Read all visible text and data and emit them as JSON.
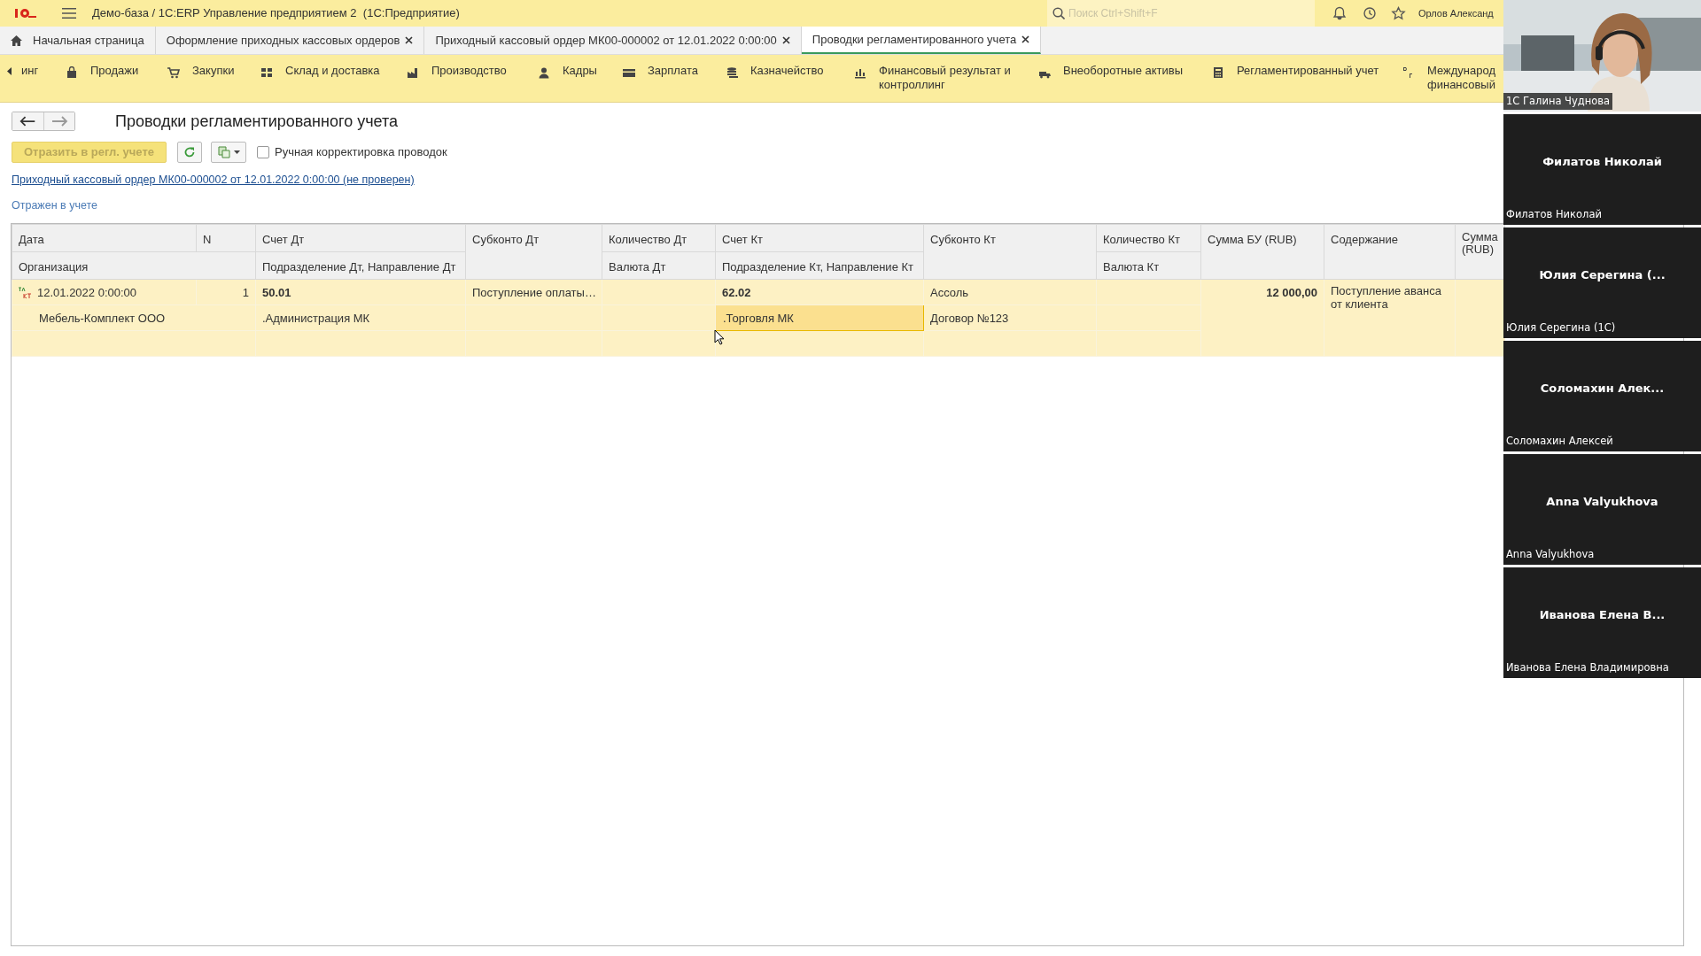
{
  "app": {
    "title": "Демо-база / 1С:ERP Управление предприятием 2  (1С:Предприятие)",
    "search_placeholder": "Поиск Ctrl+Shift+F",
    "user": "Орлов Александ"
  },
  "tabs": [
    {
      "label": "Начальная страница",
      "selected": false,
      "closable": false
    },
    {
      "label": "Оформление приходных кассовых ордеров",
      "selected": false,
      "closable": true
    },
    {
      "label": "Приходный кассовый ордер МК00-000002 от 12.01.2022 0:00:00",
      "selected": false,
      "closable": true
    },
    {
      "label": "Проводки регламентированного учета",
      "selected": true,
      "closable": true
    }
  ],
  "sections": [
    {
      "label": "инг"
    },
    {
      "label": "Продажи"
    },
    {
      "label": "Закупки"
    },
    {
      "label": "Склад и доставка"
    },
    {
      "label": "Производство"
    },
    {
      "label": "Кадры"
    },
    {
      "label": "Зарплата"
    },
    {
      "label": "Казначейство"
    },
    {
      "label": "Финансовый результат и контроллинг"
    },
    {
      "label": "Внеоборотные активы"
    },
    {
      "label": "Регламентированный учет"
    },
    {
      "label": "Международ финансовый"
    }
  ],
  "page": {
    "title": "Проводки регламентированного учета",
    "post_button": {
      "label": "Отразить в регл. учете",
      "disabled": true
    },
    "manual_checkbox": {
      "label": "Ручная корректировка проводок",
      "checked": false
    },
    "document_link": "Приходный кассовый ордер МК00-000002 от 12.01.2022 0:00:00 (не проверен)",
    "status": "Отражен в учете"
  },
  "table": {
    "header_top": [
      "Дата",
      "N",
      "Счет Дт",
      "Субконто Дт",
      "Количество Дт",
      "Счет Кт",
      "Субконто Кт",
      "Количество Кт",
      "Сумма БУ (RUB)",
      "Содержание",
      "Сумма (RUB)"
    ],
    "header_bottom": [
      "Организация",
      "Подразделение Дт, Направление Дт",
      "Валюта Дт",
      "Подразделение Кт, Направление Кт",
      "Валюта Кт"
    ],
    "rows": [
      {
        "date": "12.01.2022 0:00:00",
        "n": "1",
        "account_dt": "50.01",
        "subconto_dt": "Поступление оплаты…",
        "account_kt": "62.02",
        "subconto_kt": "Ассоль",
        "amount": "12 000,00",
        "content": "Поступление аванса от клиента",
        "organization": "Мебель-Комплект ООО",
        "division_dt": ".Администрация МК",
        "division_kt": ".Торговля МК",
        "subconto_kt_2": "Договор №123",
        "selected": true
      }
    ]
  },
  "participants": [
    {
      "kind": "video",
      "caption": "1С Галина Чуднова"
    },
    {
      "kind": "name",
      "display": "Филатов Николай",
      "caption": "Филатов Николай"
    },
    {
      "kind": "name",
      "display": "Юлия Серегина (...",
      "caption": "Юлия Серегина (1С)"
    },
    {
      "kind": "name",
      "display": "Соломахин Алек...",
      "caption": "Соломахин Алексей"
    },
    {
      "kind": "name",
      "display": "Anna Valyukhova",
      "caption": "Anna Valyukhova"
    },
    {
      "kind": "name",
      "display": "Иванова Елена В...",
      "caption": "Иванова Елена Владимировна"
    }
  ]
}
